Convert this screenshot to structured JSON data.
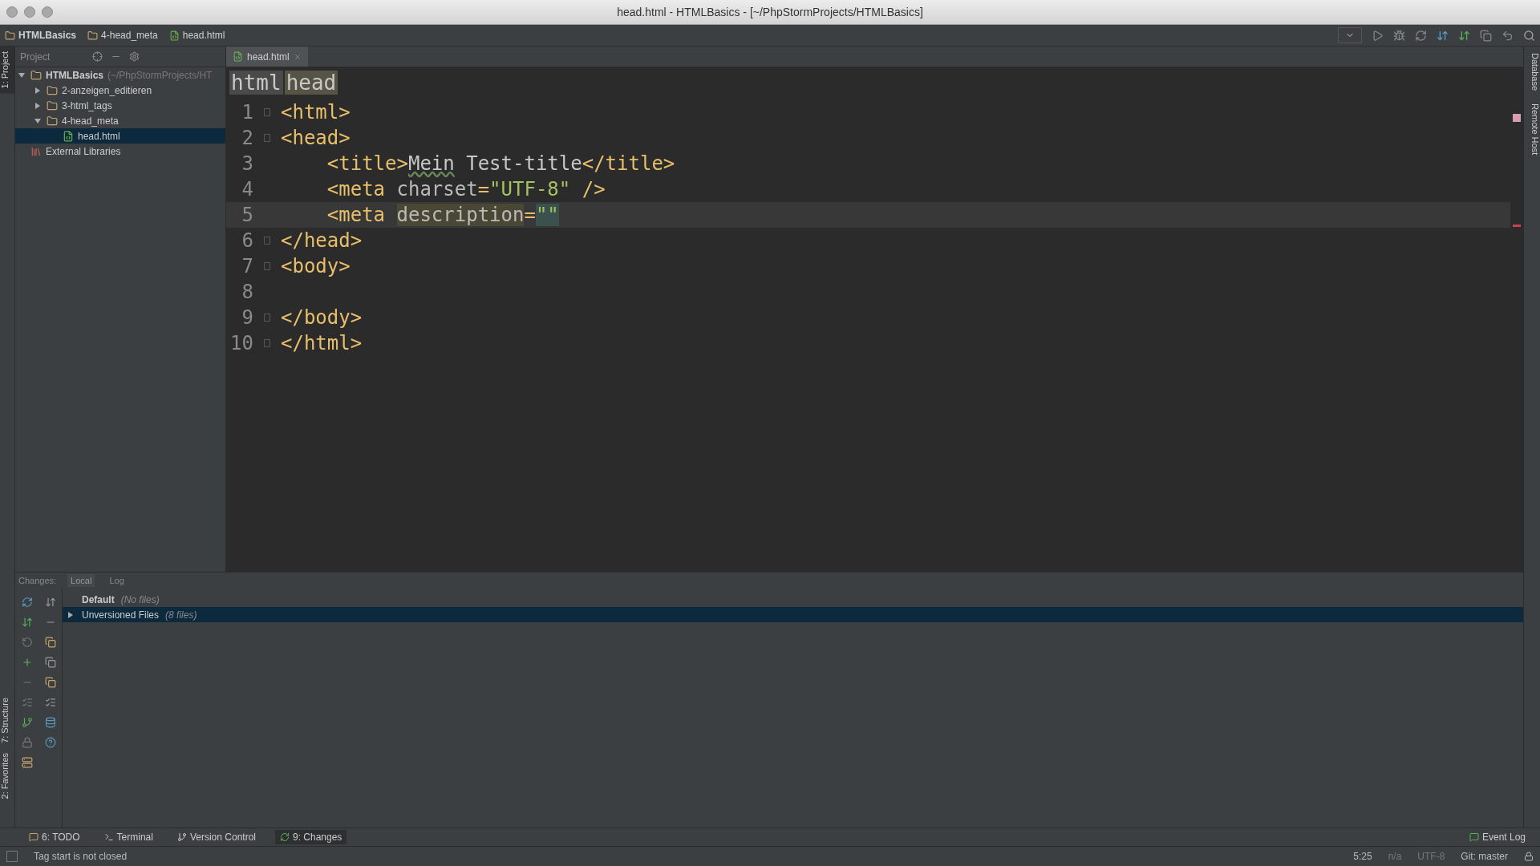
{
  "window": {
    "title": "head.html - HTMLBasics - [~/PhpStormProjects/HTMLBasics]"
  },
  "breadcrumbs": [
    "HTMLBasics",
    "4-head_meta",
    "head.html"
  ],
  "left_strip": [
    {
      "label": "1: Project",
      "selected": true
    },
    {
      "label": "7: Structure",
      "selected": false
    },
    {
      "label": "2: Favorites",
      "selected": false
    }
  ],
  "right_strip": [
    "Database",
    "Remote Host"
  ],
  "project_panel": {
    "title": "Project",
    "tree": [
      {
        "label": "HTMLBasics",
        "hint": "(~/PhpStormProjects/HT",
        "kind": "folder",
        "expanded": true,
        "selected": false,
        "children": [
          {
            "label": "2-anzeigen_editieren",
            "kind": "folder",
            "expanded": false,
            "selected": false
          },
          {
            "label": "3-html_tags",
            "kind": "folder",
            "expanded": false,
            "selected": false
          },
          {
            "label": "4-head_meta",
            "kind": "folder",
            "expanded": true,
            "selected": false,
            "children": [
              {
                "label": "head.html",
                "kind": "file",
                "selected": true
              }
            ]
          }
        ]
      },
      {
        "label": "External Libraries",
        "kind": "library",
        "selected": false
      }
    ]
  },
  "editor": {
    "tabs": [
      {
        "label": "head.html",
        "selected": true
      }
    ],
    "path": [
      "html",
      "head"
    ],
    "lines": [
      {
        "number": "1",
        "fold": true,
        "current": false,
        "tokens": [
          {
            "text": "<html>",
            "kind": "tag"
          }
        ]
      },
      {
        "number": "2",
        "fold": true,
        "current": false,
        "tokens": [
          {
            "text": "<head>",
            "kind": "tag"
          }
        ]
      },
      {
        "number": "3",
        "fold": false,
        "current": false,
        "tokens": [
          {
            "text": "    <title>",
            "kind": "tag"
          },
          {
            "text": "Mein",
            "kind": "typo"
          },
          {
            "text": " Test-title",
            "kind": "text"
          },
          {
            "text": "</title>",
            "kind": "tag"
          }
        ]
      },
      {
        "number": "4",
        "fold": false,
        "current": false,
        "tokens": [
          {
            "text": "    <meta ",
            "kind": "tag"
          },
          {
            "text": "charset",
            "kind": "attr"
          },
          {
            "text": "=",
            "kind": "tag"
          },
          {
            "text": "\"UTF-8\"",
            "kind": "value"
          },
          {
            "text": " />",
            "kind": "tag"
          }
        ]
      },
      {
        "number": "5",
        "fold": false,
        "current": true,
        "tokens": [
          {
            "text": "    <meta ",
            "kind": "tag"
          },
          {
            "text": "description",
            "kind": "marked"
          },
          {
            "text": "=",
            "kind": "tag"
          },
          {
            "text": "\"\"",
            "kind": "caret"
          }
        ]
      },
      {
        "number": "6",
        "fold": true,
        "current": false,
        "tokens": [
          {
            "text": "</head>",
            "kind": "tag"
          }
        ]
      },
      {
        "number": "7",
        "fold": true,
        "current": false,
        "tokens": [
          {
            "text": "<body>",
            "kind": "tag"
          }
        ]
      },
      {
        "number": "8",
        "fold": false,
        "current": false
      },
      {
        "number": "9",
        "fold": true,
        "current": false,
        "tokens": [
          {
            "text": "</body>",
            "kind": "tag"
          }
        ]
      },
      {
        "number": "10",
        "fold": true,
        "current": false,
        "tokens": [
          {
            "text": "</html>",
            "kind": "tag"
          }
        ]
      }
    ]
  },
  "changes_panel": {
    "label": "Changes:",
    "tabs": [
      {
        "label": "Local",
        "selected": true
      },
      {
        "label": "Log",
        "selected": false
      }
    ],
    "rows": [
      {
        "label": "Default",
        "hint": "(No files)",
        "expandable": false,
        "selected": false
      },
      {
        "label": "Unversioned Files",
        "hint": "(8 files)",
        "expandable": true,
        "selected": true
      }
    ]
  },
  "tool_buttons": [
    {
      "label": "6: TODO",
      "selected": false
    },
    {
      "label": "Terminal",
      "selected": false
    },
    {
      "label": "Version Control",
      "selected": false
    },
    {
      "label": "9: Changes",
      "selected": true
    }
  ],
  "event_log": "Event Log",
  "status_bar": {
    "message": "Tag start is not closed",
    "items": [
      "5:25",
      "n/a",
      "UTF-8",
      "Git: master"
    ]
  }
}
